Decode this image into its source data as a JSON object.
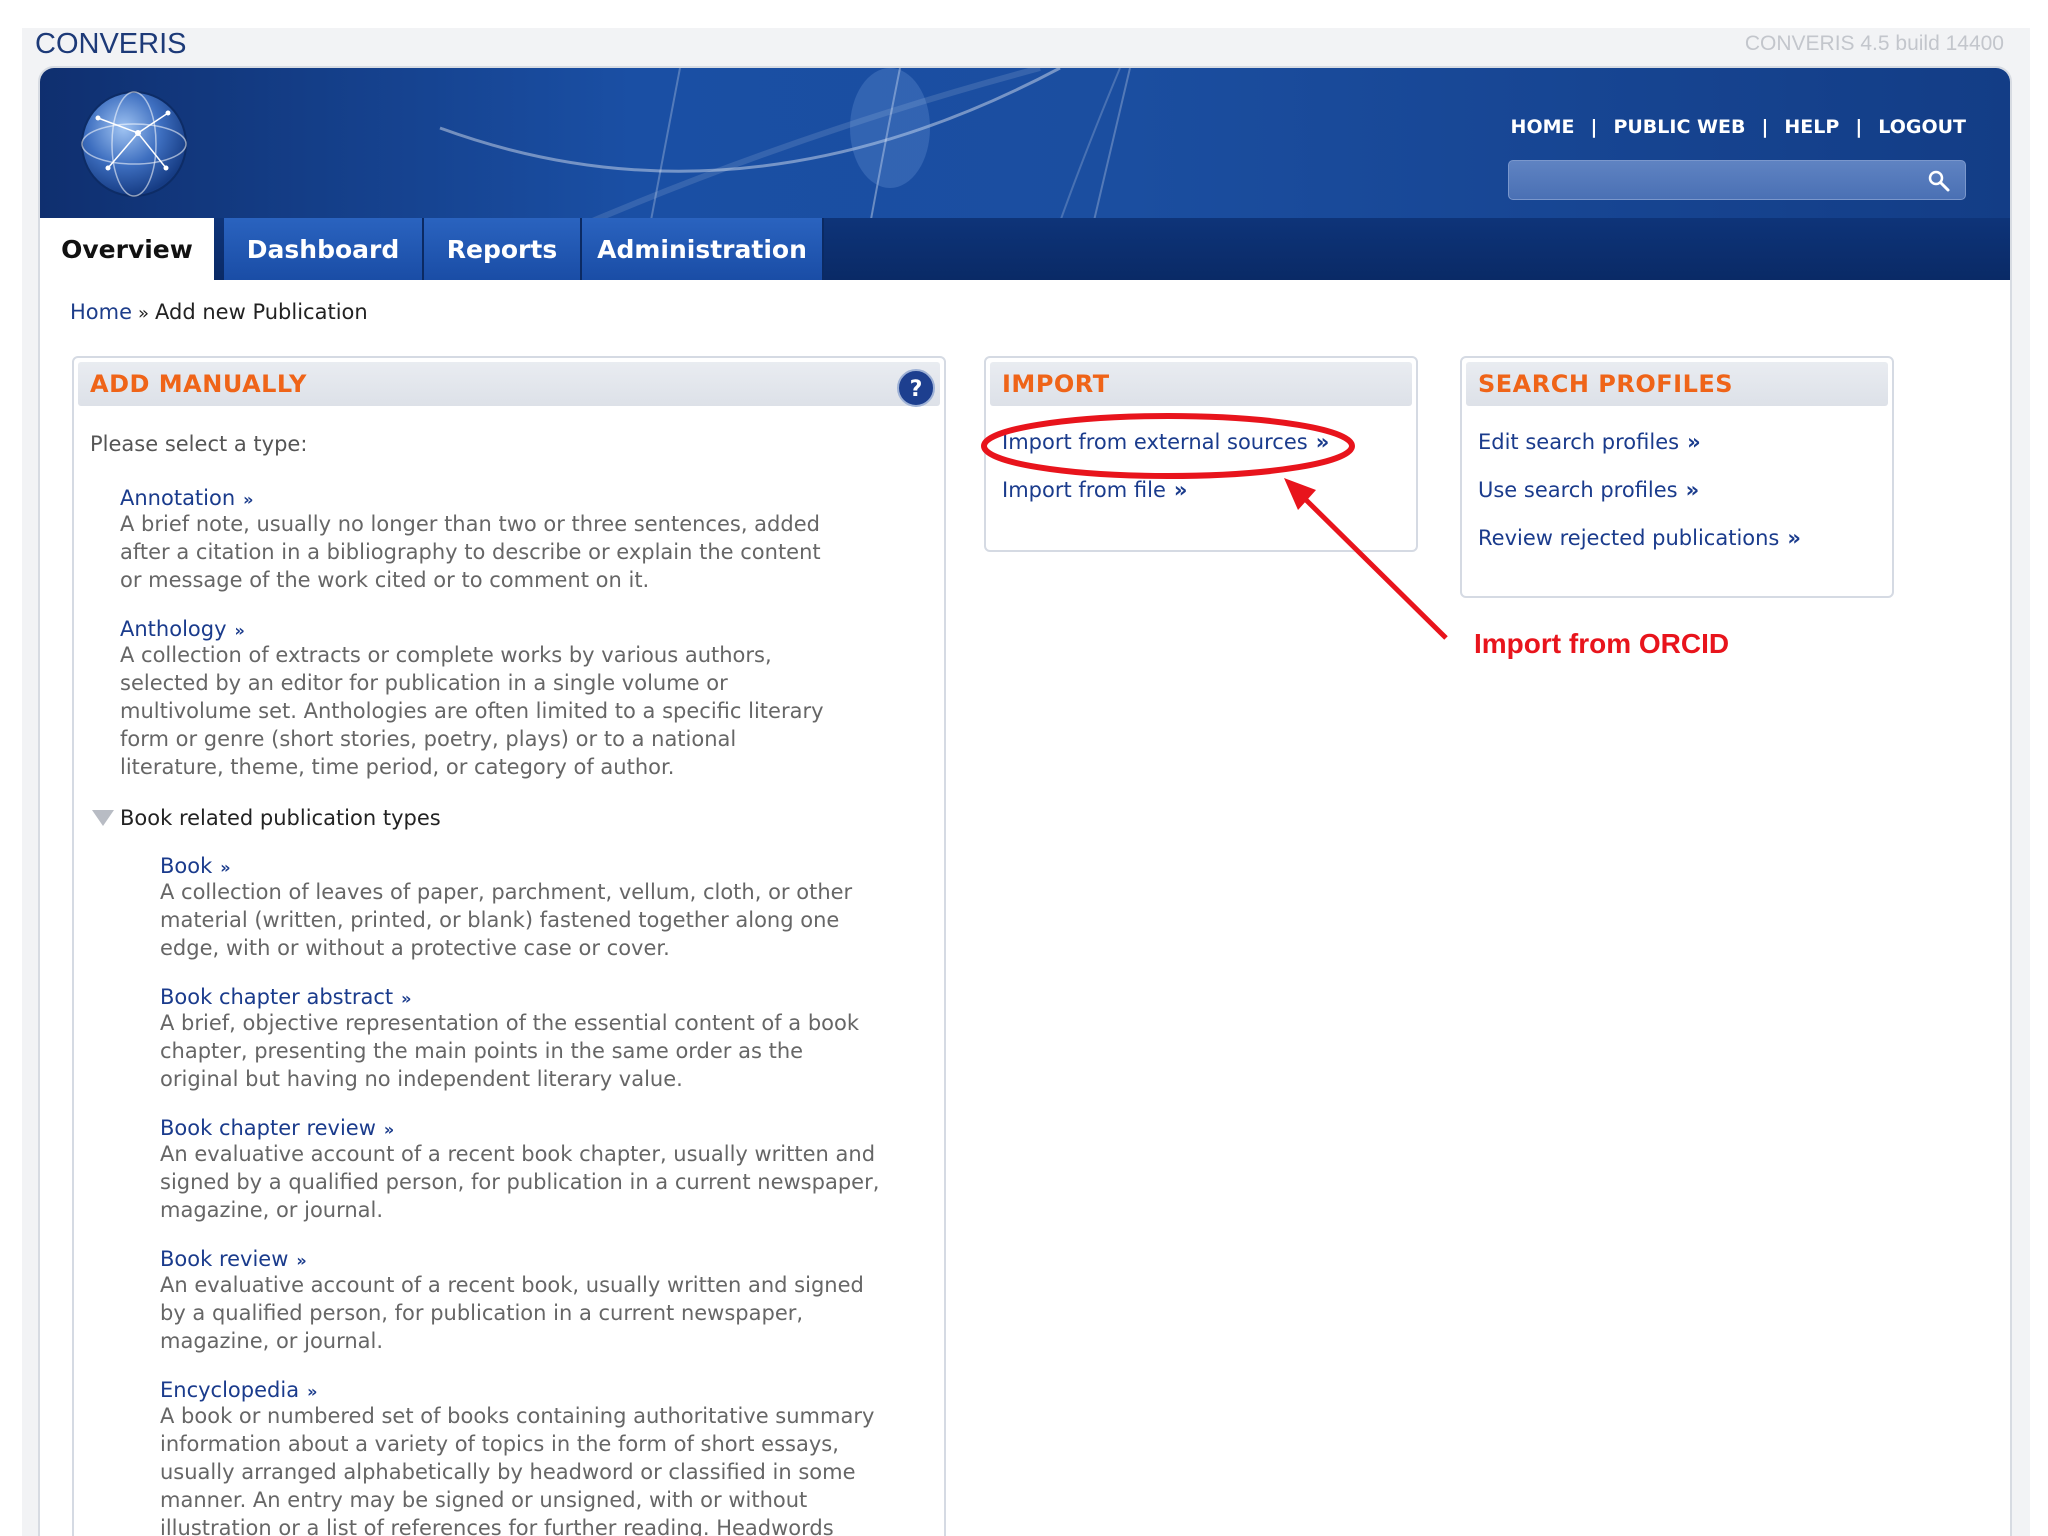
{
  "app": {
    "title": "CONVERIS",
    "build": "CONVERIS 4.5 build 14400"
  },
  "header": {
    "links": [
      {
        "label": "HOME"
      },
      {
        "label": "PUBLIC WEB"
      },
      {
        "label": "HELP"
      },
      {
        "label": "LOGOUT"
      }
    ],
    "separator": "|",
    "search": {
      "value": "",
      "placeholder": ""
    }
  },
  "nav": {
    "tabs": [
      {
        "label": "Overview",
        "active": true
      },
      {
        "label": "Dashboard"
      },
      {
        "label": "Reports"
      },
      {
        "label": "Administration"
      }
    ]
  },
  "breadcrumb": {
    "home": "Home",
    "separator": "»",
    "current": "Add new Publication"
  },
  "add_manually": {
    "title": "ADD MANUALLY",
    "prompt": "Please select a type:",
    "items": [
      {
        "label": "Annotation",
        "desc_lines": [
          "A brief note, usually no longer than two or three sentences, added",
          "after a citation in a bibliography to describe or explain the content",
          "or message of the work cited or to comment on it."
        ]
      },
      {
        "label": "Anthology",
        "desc_lines": [
          "A collection of extracts or complete works by various authors,",
          "selected by an editor for publication in a single volume or",
          "multivolume set. Anthologies are often limited to a specific literary",
          "form or genre (short stories, poetry, plays) or to a national",
          "literature, theme, time period, or category of author."
        ]
      }
    ],
    "group": {
      "label": "Book related publication types",
      "items": [
        {
          "label": "Book",
          "desc_lines": [
            "A collection of leaves of paper, parchment, vellum, cloth, or other",
            "material (written, printed, or blank) fastened together along one",
            "edge, with or without a protective case or cover."
          ]
        },
        {
          "label": "Book chapter abstract",
          "desc_lines": [
            "A brief, objective representation of the essential content of a book",
            "chapter, presenting the main points in the same order as the",
            "original but having no independent literary value."
          ]
        },
        {
          "label": "Book chapter review",
          "desc_lines": [
            "An evaluative account of a recent book chapter, usually written and",
            "signed by a qualified person, for publication in a current newspaper,",
            "magazine, or journal."
          ]
        },
        {
          "label": "Book review",
          "desc_lines": [
            "An evaluative account of a recent book, usually written and signed",
            "by a qualified person, for publication in a current newspaper,",
            "magazine, or journal."
          ]
        },
        {
          "label": "Encyclopedia",
          "desc_lines": [
            "A book or numbered set of books containing authoritative summary",
            "information about a variety of topics in the form of short essays,",
            "usually arranged alphabetically by headword or classified in some",
            "manner. An entry may be signed or unsigned, with or without",
            "illustration or a list of references for further reading. Headwords"
          ]
        }
      ]
    }
  },
  "import": {
    "title": "IMPORT",
    "links": [
      {
        "label": "Import from external sources"
      },
      {
        "label": "Import from file"
      }
    ]
  },
  "search_profiles": {
    "title": "SEARCH PROFILES",
    "links": [
      {
        "label": "Edit search profiles"
      },
      {
        "label": "Use search profiles"
      },
      {
        "label": "Review rejected publications"
      }
    ]
  },
  "annotation": {
    "label": "Import from ORCID",
    "color": "#e8141c"
  },
  "chevron": "»",
  "colors": {
    "accent": "#ef6418",
    "link": "#1a3b8c",
    "banner": "#1a4fa4",
    "nav": "#0e3479"
  },
  "icons": [
    "globe-logo-icon",
    "search-icon",
    "help-icon",
    "triangle-down-icon"
  ]
}
